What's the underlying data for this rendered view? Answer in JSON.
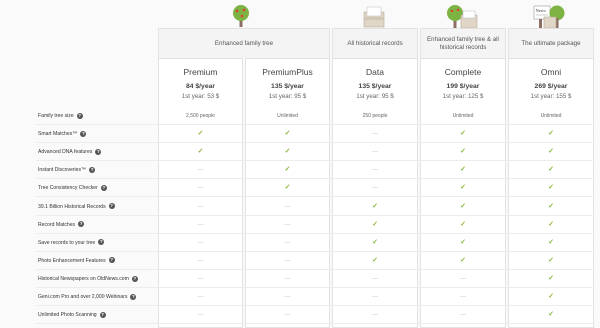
{
  "groups": [
    {
      "label": "Enhanced family tree"
    },
    {
      "label": "All historical records"
    },
    {
      "label": "Enhanced family tree & all historical records"
    },
    {
      "label": "The ultimate package"
    }
  ],
  "plans": [
    {
      "name": "Premium",
      "price": "84 $/year",
      "first_year": "1st year: 53 $"
    },
    {
      "name": "PremiumPlus",
      "price": "135 $/year",
      "first_year": "1st year: 95 $"
    },
    {
      "name": "Data",
      "price": "135 $/year",
      "first_year": "1st year: 95 $"
    },
    {
      "name": "Complete",
      "price": "199 $/year",
      "first_year": "1st year: 125 $"
    },
    {
      "name": "Omni",
      "price": "269 $/year",
      "first_year": "1st year: 155 $"
    }
  ],
  "icons": {
    "tree": "tree-icon",
    "records": "records-box-icon",
    "tree_records": "tree-and-records-icon",
    "news_box": "newspaper-box-icon",
    "help": "?"
  },
  "colors": {
    "check": "#8ab43a",
    "tree_green": "#7cb342",
    "trunk": "#8d6e63",
    "box": "#e0d6c8"
  },
  "features": [
    {
      "label": "Family tree size",
      "values": [
        "2,500 people",
        "Unlimited",
        "250 people",
        "Unlimited",
        "Unlimited"
      ]
    },
    {
      "label": "Smart Matches™",
      "values": [
        "check",
        "check",
        "dash",
        "check",
        "check"
      ]
    },
    {
      "label": "Advanced DNA features",
      "values": [
        "check",
        "check",
        "dash",
        "check",
        "check"
      ]
    },
    {
      "label": "Instant Discoveries™",
      "values": [
        "dash",
        "check",
        "dash",
        "check",
        "check"
      ]
    },
    {
      "label": "Tree Consistency Checker",
      "values": [
        "dash",
        "check",
        "dash",
        "check",
        "check"
      ]
    },
    {
      "label": "39.1 Billion Historical Records",
      "values": [
        "dash",
        "dash",
        "check",
        "check",
        "check"
      ]
    },
    {
      "label": "Record Matches",
      "values": [
        "dash",
        "dash",
        "check",
        "check",
        "check"
      ]
    },
    {
      "label": "Save records to your tree",
      "values": [
        "dash",
        "dash",
        "check",
        "check",
        "check"
      ]
    },
    {
      "label": "Photo Enhancement Features",
      "values": [
        "dash",
        "dash",
        "check",
        "check",
        "check"
      ]
    },
    {
      "label": "Historical Newspapers on OldNews.com",
      "values": [
        "dash",
        "dash",
        "dash",
        "dash",
        "check"
      ]
    },
    {
      "label": "Geni.com Pro and over 2,000 Webinars",
      "values": [
        "dash",
        "dash",
        "dash",
        "dash",
        "check"
      ]
    },
    {
      "label": "Unlimited Photo Scanning",
      "values": [
        "dash",
        "dash",
        "dash",
        "dash",
        "check"
      ]
    }
  ]
}
